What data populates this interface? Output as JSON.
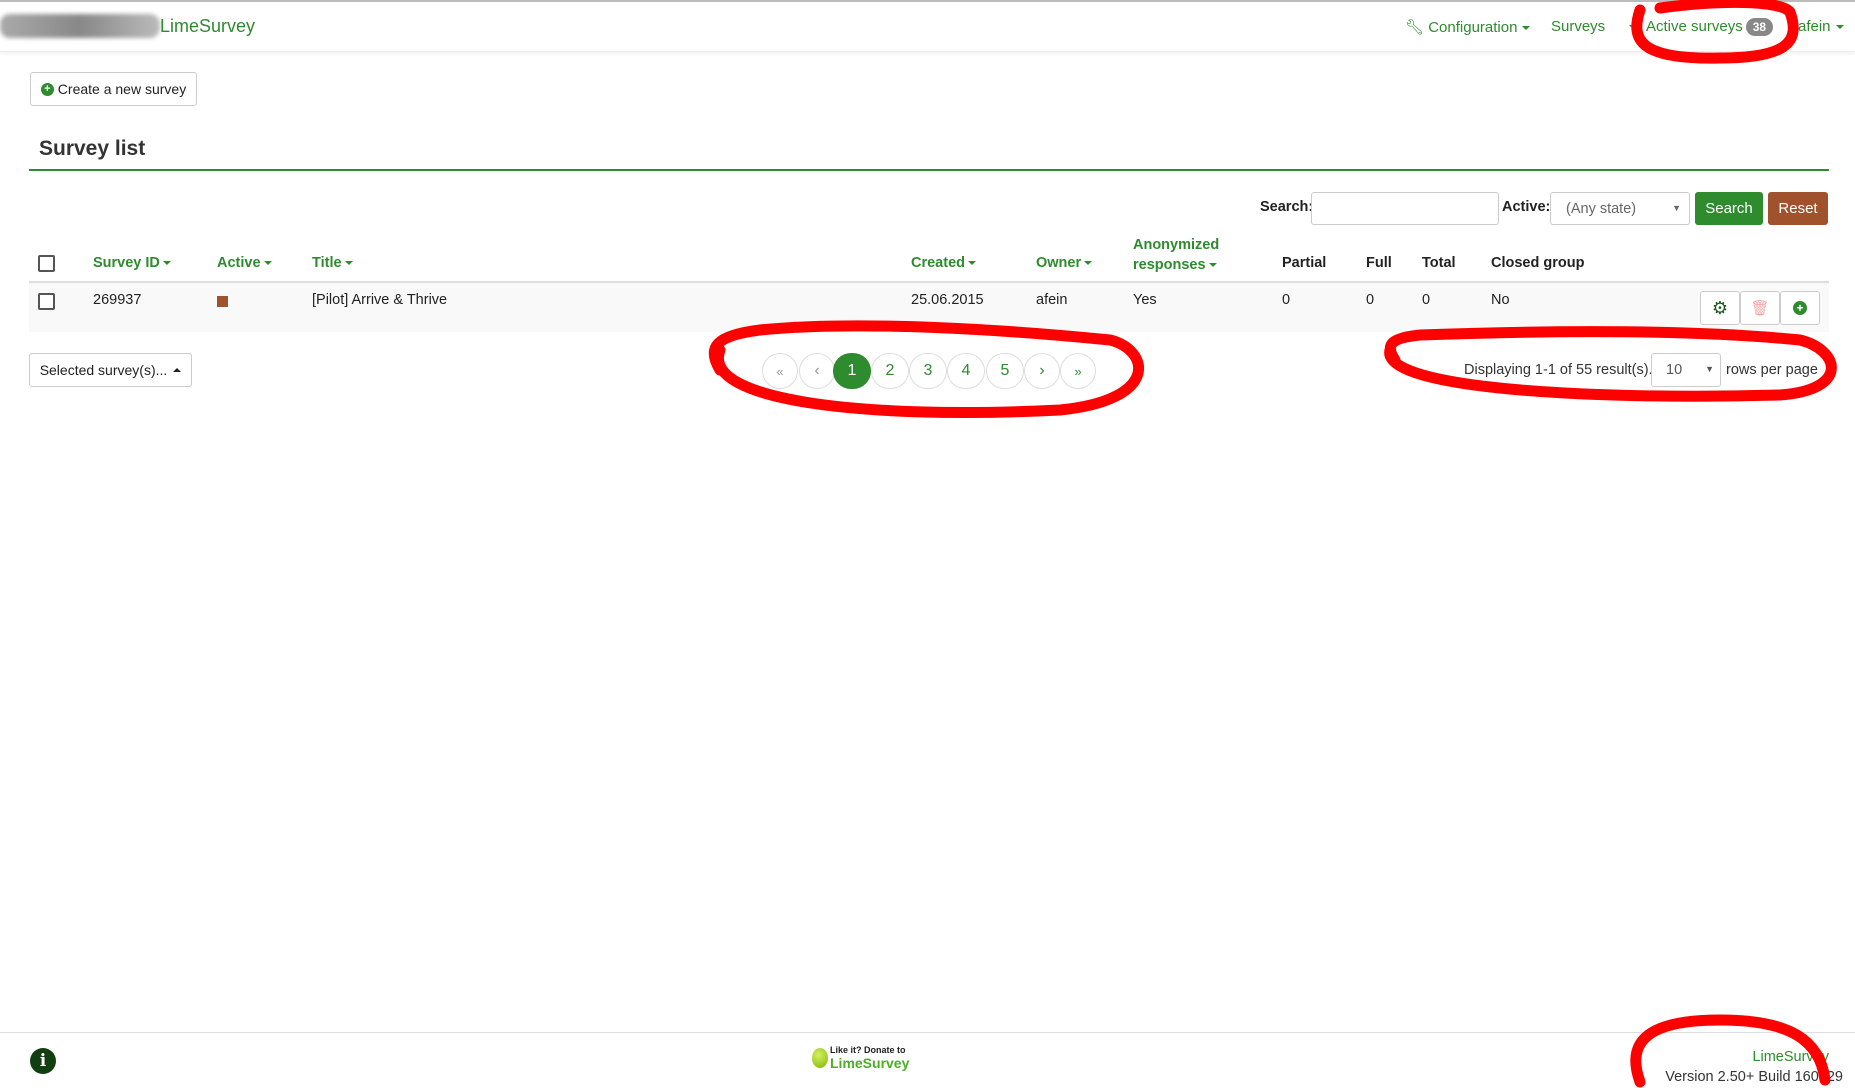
{
  "navbar": {
    "brand": "LimeSurvey",
    "configuration": "Configuration",
    "surveys": "Surveys",
    "active_surveys": "Active surveys",
    "active_count": "38",
    "user": "afein"
  },
  "toolbar": {
    "create_label": "Create a new survey"
  },
  "page_title": "Survey list",
  "filters": {
    "search_label": "Search:",
    "search_value": "",
    "active_label": "Active:",
    "active_value": "(Any state)",
    "search_button": "Search",
    "reset_button": "Reset"
  },
  "table": {
    "headers": {
      "survey_id": "Survey ID",
      "active": "Active",
      "title": "Title",
      "created": "Created",
      "owner": "Owner",
      "anon_1": "Anonymized",
      "anon_2": "responses",
      "partial": "Partial",
      "full": "Full",
      "total": "Total",
      "closed_group": "Closed group"
    },
    "rows": [
      {
        "survey_id": "269937",
        "active_color": "#a0522d",
        "title": "[Pilot] Arrive & Thrive",
        "created": "25.06.2015",
        "owner": "afein",
        "anonymized": "Yes",
        "partial": "0",
        "full": "0",
        "total": "0",
        "closed_group": "No"
      }
    ]
  },
  "bulk": {
    "label": "Selected survey(s)..."
  },
  "pagination": {
    "first": "«",
    "prev": "‹",
    "pages": [
      "1",
      "2",
      "3",
      "4",
      "5"
    ],
    "current": "1",
    "next": "›",
    "last": "»"
  },
  "summary": {
    "text": "Displaying 1-1 of 55 result(s).",
    "rows_per_page": "10",
    "rows_label": "rows per page"
  },
  "footer": {
    "donate_line1": "Like it? Donate to",
    "donate_line2": "LimeSurvey",
    "brand": "LimeSurvey",
    "version": "Version 2.50+ Build 160529"
  },
  "colors": {
    "accent": "#2e8b2e",
    "reset": "#a0522d",
    "annotation": "#ff0000"
  }
}
